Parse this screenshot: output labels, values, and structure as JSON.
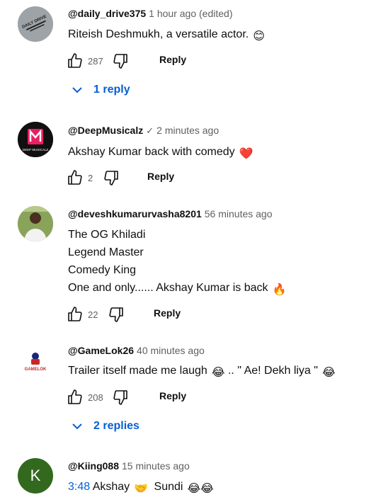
{
  "comments": [
    {
      "handle": "@daily_drive375",
      "time": "1 hour ago (edited)",
      "lines": [
        "Riteish Deshmukh, a versatile actor."
      ],
      "emoji": "😊",
      "likes": "287",
      "reply_label": "Reply",
      "replies_label": "1 reply",
      "avatar_text": "DAILY DRIVE"
    },
    {
      "handle": "@DeepMusicalz",
      "verified": "✓",
      "time": "2 minutes ago",
      "lines": [
        "Akshay Kumar back with comedy"
      ],
      "emoji": "❤️",
      "likes": "2",
      "reply_label": "Reply",
      "avatar_text": "DEEP MUSICALZ"
    },
    {
      "handle": "@deveshkumarurvasha8201",
      "time": "56 minutes ago",
      "lines": [
        "The OG Khiladi",
        "Legend Master",
        "Comedy King",
        "One and only...... Akshay Kumar is back"
      ],
      "emoji": "🔥",
      "likes": "22",
      "reply_label": "Reply"
    },
    {
      "handle": "@GameLok26",
      "time": "40 minutes ago",
      "line_a": "Trailer itself made me laugh",
      "line_b": ".. \" Ae! Dekh liya \"",
      "emoji": "😂",
      "likes": "208",
      "reply_label": "Reply",
      "replies_label": "2 replies",
      "avatar_text": "GAMELOK"
    },
    {
      "handle": "@Kiing088",
      "time": "15 minutes ago",
      "timestamp": "3:48",
      "word_a": "Akshay",
      "emoji_a": "🤝",
      "word_b": "Sundi",
      "emoji_b": "😂😂",
      "avatar_letter": "K"
    }
  ],
  "colors": {
    "link": "#065fd4",
    "muted": "#606060",
    "avatar_k": "#33691e"
  }
}
